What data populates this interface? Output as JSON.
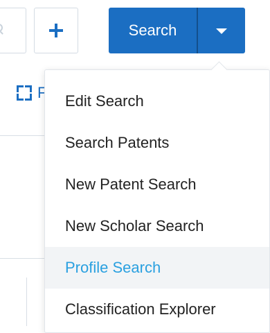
{
  "toolbar": {
    "search_label": "Search",
    "expand_label_partial": "F"
  },
  "dropdown": {
    "items": [
      {
        "label": "Edit Search"
      },
      {
        "label": "Search Patents"
      },
      {
        "label": "New Patent Search"
      },
      {
        "label": "New Scholar Search"
      },
      {
        "label": "Profile Search",
        "state": "hovered"
      },
      {
        "label": "Classification Explorer"
      }
    ]
  },
  "icons": {
    "search_input": "search-icon",
    "add": "plus-icon",
    "dropdown_toggle": "chevron-down-icon",
    "expand": "expand-icon"
  },
  "colors": {
    "primary": "#1b6ec2",
    "primary_divider": "#134f8c",
    "hover_text": "#2aa0e0",
    "hover_background": "#f2f4f6",
    "border": "#d3dbe3",
    "text": "#222222"
  }
}
